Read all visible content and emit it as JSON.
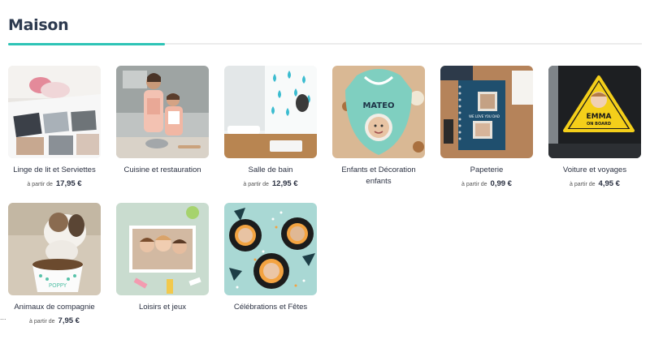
{
  "page": {
    "title": "Maison",
    "price_prefix": "à partir de",
    "more_indicator": "..."
  },
  "colors": {
    "accent": "#2ec4b6",
    "title": "#2d3a4f"
  },
  "categories": [
    {
      "title": "Linge de lit et Serviettes",
      "price": "17,95 €",
      "image": "bedding-photo"
    },
    {
      "title": "Cuisine et restauration",
      "price": "",
      "image": "kitchen-photo"
    },
    {
      "title": "Salle de bain",
      "price": "12,95 €",
      "image": "bathroom-photo"
    },
    {
      "title": "Enfants et Décoration enfants",
      "price": "",
      "image": "baby-bib-photo"
    },
    {
      "title": "Papeterie",
      "price": "0,99 €",
      "image": "notebook-photo"
    },
    {
      "title": "Voiture et voyages",
      "price": "4,95 €",
      "image": "car-sign-photo"
    },
    {
      "title": "Animaux de compagnie",
      "price": "7,95 €",
      "image": "dog-bowl-photo"
    },
    {
      "title": "Loisirs et jeux",
      "price": "",
      "image": "puzzle-photo"
    },
    {
      "title": "Célébrations et Fêtes",
      "price": "",
      "image": "party-plates-photo"
    }
  ],
  "thumb_text": {
    "bib_name": "MATEO",
    "car_sign_name": "EMMA",
    "car_sign_sub": "ON BOARD",
    "bowl_name": "POPPY",
    "notebook_caption": "WE LOVE YOU DAD"
  }
}
